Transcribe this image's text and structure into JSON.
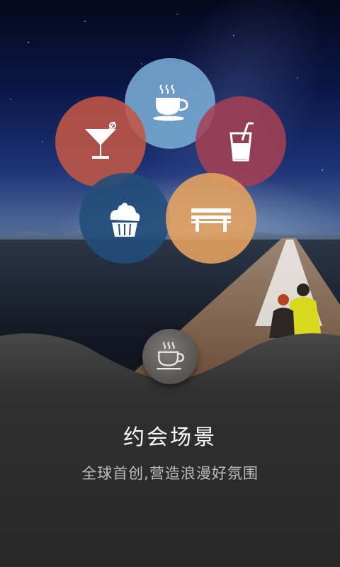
{
  "scene": {
    "title": "约会场景",
    "subtitle": "全球首创,营造浪漫好氛围"
  },
  "menu_circles": [
    {
      "name": "coffee",
      "icon": "coffee-cup-icon",
      "color": "#7aacd6"
    },
    {
      "name": "cocktail",
      "icon": "cocktail-glass-icon",
      "color": "#c15646"
    },
    {
      "name": "juice",
      "icon": "juice-glass-icon",
      "color": "#a54053"
    },
    {
      "name": "muffin",
      "icon": "muffin-icon",
      "color": "#224c7a"
    },
    {
      "name": "bench",
      "icon": "bench-icon",
      "color": "#e6a35f"
    }
  ],
  "selected": {
    "icon": "coffee-cup-icon"
  },
  "colors": {
    "panel_bg": "#2b2b2b",
    "title_text": "#ffffff",
    "subtitle_text": "#bdbdbd"
  }
}
